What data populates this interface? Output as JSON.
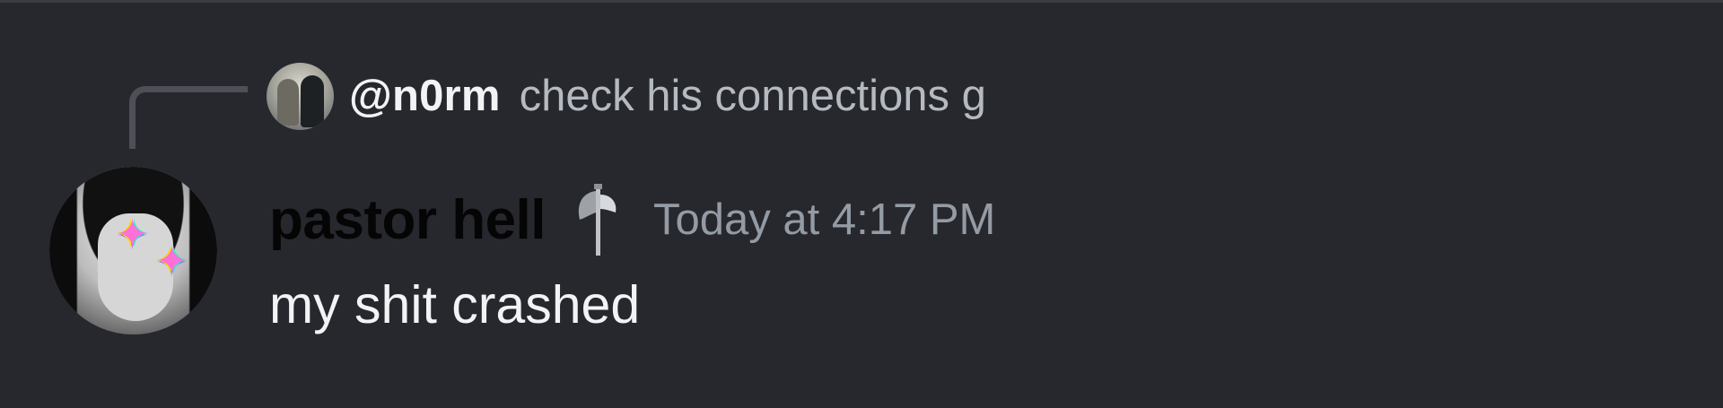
{
  "reply": {
    "author": "@n0rm",
    "text": "check his connections g"
  },
  "message": {
    "author": "pastor hell",
    "role_icon": "axe-icon",
    "timestamp": "Today at 4:17 PM",
    "content": "my shit crashed"
  },
  "colors": {
    "background": "#27282e",
    "spine": "#4e5058",
    "reply_author": "#f2f3f5",
    "reply_text": "#b5bac1",
    "author_name": "#050505",
    "timestamp": "#949ba4",
    "message_text": "#f2f3f5"
  }
}
